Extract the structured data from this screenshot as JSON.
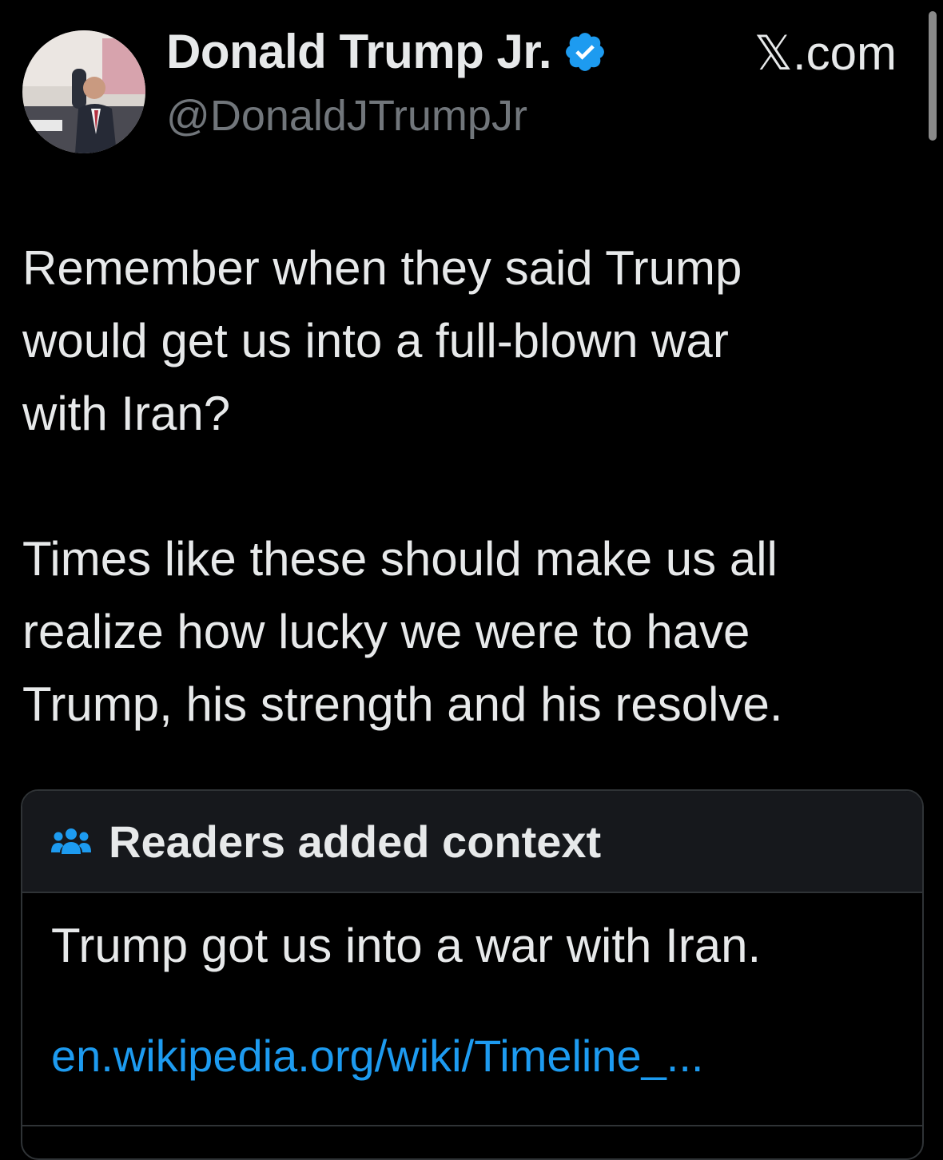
{
  "author": {
    "display_name": "Donald Trump Jr.",
    "handle": "@DonaldJTrumpJr",
    "verified": true,
    "avatar_icon": "profile-photo"
  },
  "source": {
    "x_glyph": "𝕏",
    "domain": ".com"
  },
  "tweet": {
    "paragraphs": [
      "Remember when they said Trump\nwould get us into a full-blown war\nwith Iran?",
      "Times like these should make us all\nrealize how lucky we were to have\nTrump, his strength and his resolve."
    ]
  },
  "community_note": {
    "title": "Readers added context",
    "icon": "people-icon",
    "text": "Trump got us into a war with Iran.",
    "link": "en.wikipedia.org/wiki/Timeline_..."
  },
  "colors": {
    "background": "#000000",
    "text_primary": "#e7e9ea",
    "text_secondary": "#71767b",
    "link": "#1d9bf0",
    "verified_badge": "#1d9bf0",
    "border": "#2f3336",
    "note_header_bg": "#16181c"
  }
}
